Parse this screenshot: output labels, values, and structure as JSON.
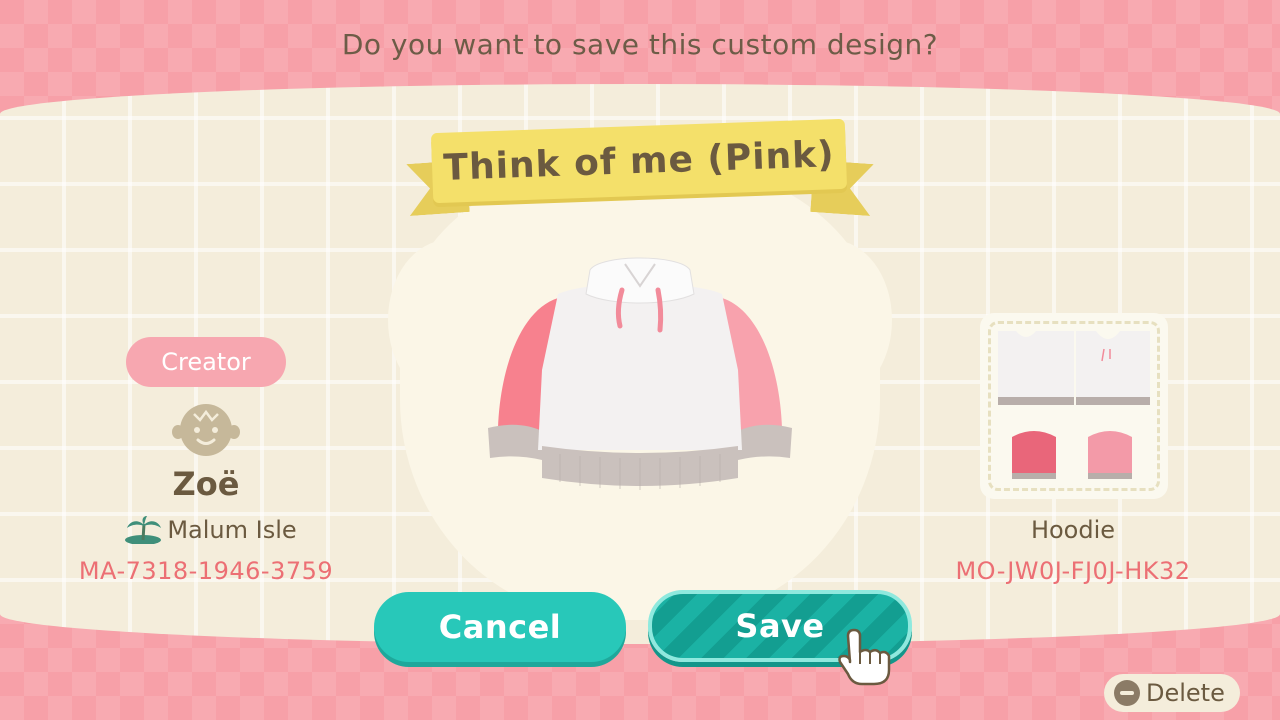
{
  "dialog": {
    "question": "Do you want to save this custom design?"
  },
  "design": {
    "title": "Think of me (Pink)",
    "item_type": "Hoodie",
    "design_id": "MO-JW0J-FJ0J-HK32",
    "colors": {
      "body": "#f2f0f0",
      "sleeves": "#f7818e",
      "cuffs": "#c9c0bc",
      "strings": "#f28b9a"
    }
  },
  "creator": {
    "section_label": "Creator",
    "name": "Zoë",
    "island": "Malum Isle",
    "creator_id": "MA-7318-1946-3759",
    "avatar_icon": "villager-face-icon",
    "island_icon": "palm-island-icon"
  },
  "buttons": {
    "cancel_label": "Cancel",
    "save_label": "Save",
    "delete_label": "Delete"
  },
  "theme": {
    "frame_pink": "#f7a0a8",
    "panel_cream": "#f4eddb",
    "banner_yellow": "#f4e06a",
    "button_teal": "#28c8b9",
    "id_text_red": "#ec6f74",
    "text_brown": "#6b5a40"
  }
}
